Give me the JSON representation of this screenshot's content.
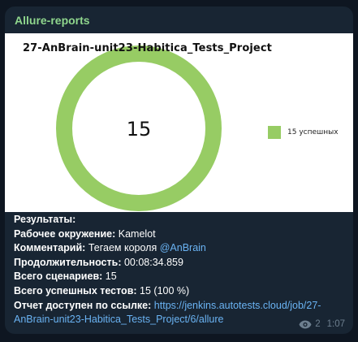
{
  "message": {
    "sender": "Allure-reports",
    "views": "2",
    "time": "1:07"
  },
  "chart_data": {
    "type": "pie",
    "title": "27-AnBrain-unit23-Habitica_Tests_Project",
    "center_label": "15",
    "slices": [
      {
        "label": "15 успешных",
        "value": 15,
        "color": "#97cc64"
      }
    ],
    "legend_position": "right"
  },
  "report": {
    "results_label": "Результаты:",
    "env_label": "Рабочее окружение:",
    "env_value": "Kamelot",
    "comment_label": "Комментарий:",
    "comment_text": "Тегаем короля",
    "comment_mention": "@AnBrain",
    "duration_label": "Продолжительность:",
    "duration_value": "00:08:34.859",
    "scenarios_label": "Всего сценариев:",
    "scenarios_value": "15",
    "passed_label": "Всего успешных тестов:",
    "passed_value": "15 (100 %)",
    "link_label": "Отчет доступен по ссылке:",
    "link_part1": "https://jenkins.autotests.cloud/job/27-",
    "link_part2": "AnBrain-unit23-Habitica_Tests_Project/6/allure"
  }
}
